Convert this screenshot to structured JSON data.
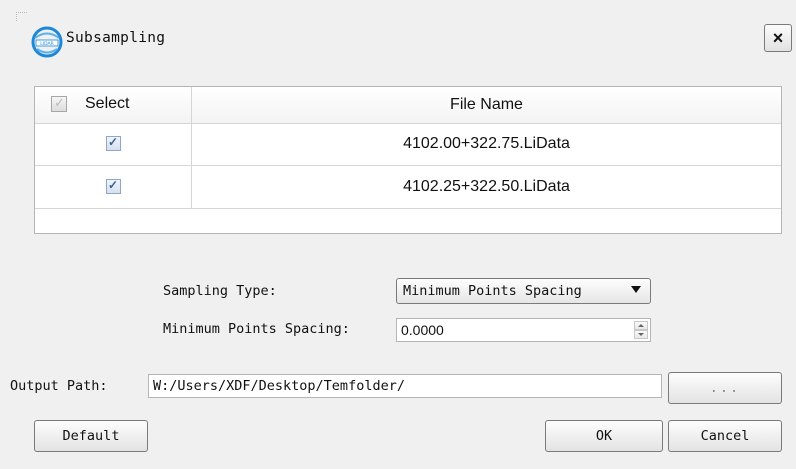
{
  "window": {
    "title": "Subsampling",
    "close_label": "×"
  },
  "table": {
    "headers": {
      "select": "Select",
      "file_name": "File Name"
    },
    "rows": [
      {
        "checked": true,
        "file_name": "4102.00+322.75.LiData"
      },
      {
        "checked": true,
        "file_name": "4102.25+322.50.LiData"
      }
    ]
  },
  "form": {
    "sampling_type_label": "Sampling Type:",
    "sampling_type_value": "Minimum Points Spacing",
    "min_spacing_label": "Minimum Points Spacing:",
    "min_spacing_value": "0.0000",
    "output_path_label": "Output Path:",
    "output_path_value": "W:/Users/XDF/Desktop/Temfolder/",
    "browse_label": "..."
  },
  "buttons": {
    "default": "Default",
    "ok": "OK",
    "cancel": "Cancel"
  },
  "colors": {
    "background": "#f0f0f0",
    "icon_blue": "#1e88d8"
  },
  "icons": {
    "app": "lidar-logo-icon",
    "close": "close-icon",
    "dropdown": "chevron-down-icon"
  }
}
